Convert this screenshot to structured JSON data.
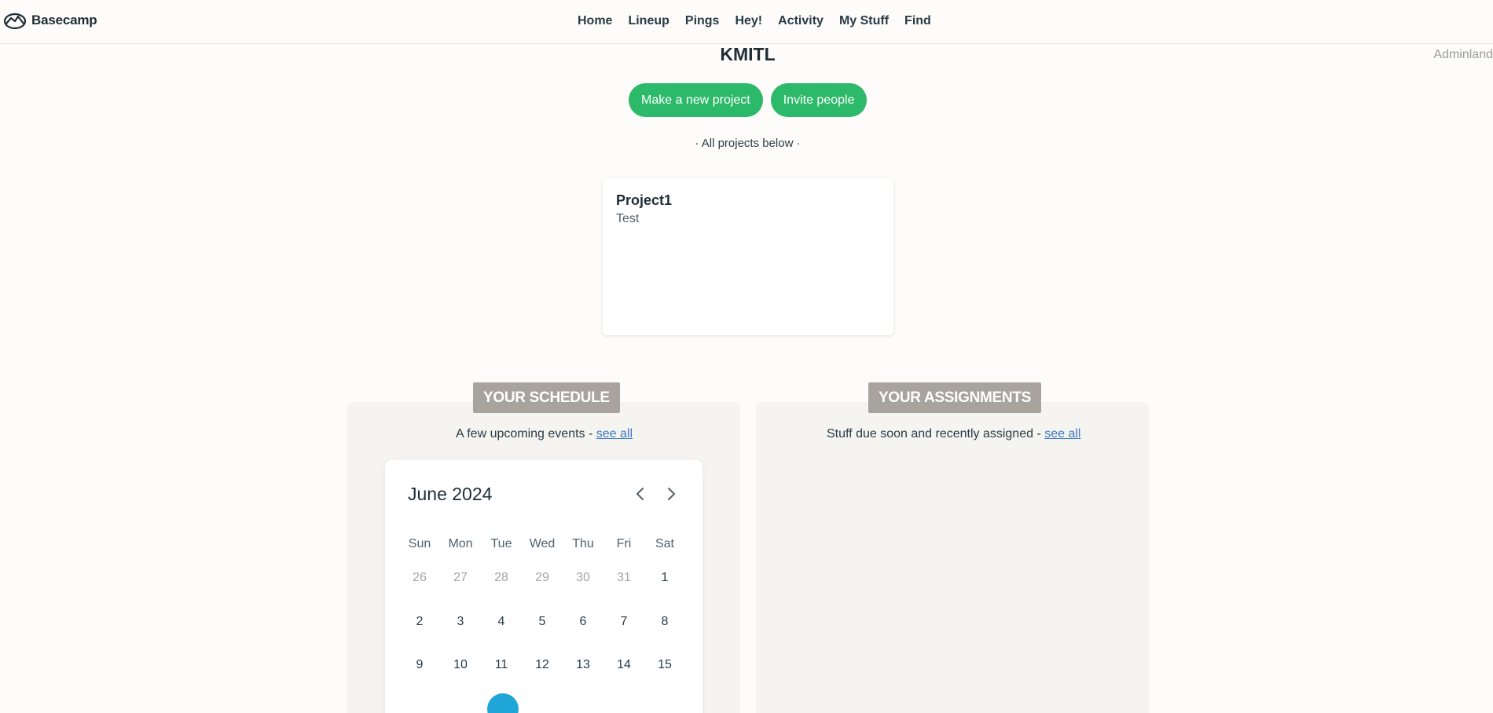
{
  "brand": {
    "name": "Basecamp"
  },
  "nav": {
    "items": [
      {
        "label": "Home"
      },
      {
        "label": "Lineup"
      },
      {
        "label": "Pings"
      },
      {
        "label": "Hey!"
      },
      {
        "label": "Activity"
      },
      {
        "label": "My Stuff"
      },
      {
        "label": "Find"
      }
    ]
  },
  "adminland": "Adminland",
  "account_name": "KMITL",
  "actions": {
    "new_project": "Make a new project",
    "invite": "Invite people"
  },
  "projects_note": "· All projects below ·",
  "project": {
    "name": "Project1",
    "description": "Test"
  },
  "schedule": {
    "tag": "YOUR SCHEDULE",
    "subtitle": "A few upcoming events - ",
    "see_all": "see all",
    "calendar": {
      "month_label": "June 2024",
      "weekdays": [
        "Sun",
        "Mon",
        "Tue",
        "Wed",
        "Thu",
        "Fri",
        "Sat"
      ],
      "weeks": [
        [
          {
            "d": "26",
            "muted": true
          },
          {
            "d": "27",
            "muted": true
          },
          {
            "d": "28",
            "muted": true
          },
          {
            "d": "29",
            "muted": true
          },
          {
            "d": "30",
            "muted": true
          },
          {
            "d": "31",
            "muted": true
          },
          {
            "d": "1"
          }
        ],
        [
          {
            "d": "2"
          },
          {
            "d": "3"
          },
          {
            "d": "4"
          },
          {
            "d": "5"
          },
          {
            "d": "6"
          },
          {
            "d": "7"
          },
          {
            "d": "8"
          }
        ],
        [
          {
            "d": "9"
          },
          {
            "d": "10"
          },
          {
            "d": "11"
          },
          {
            "d": "12"
          },
          {
            "d": "13"
          },
          {
            "d": "14"
          },
          {
            "d": "15"
          }
        ],
        [
          {
            "d": ""
          },
          {
            "d": ""
          },
          {
            "d": "",
            "today": true
          },
          {
            "d": ""
          },
          {
            "d": ""
          },
          {
            "d": ""
          },
          {
            "d": ""
          }
        ]
      ]
    }
  },
  "assignments": {
    "tag": "YOUR ASSIGNMENTS",
    "subtitle": "Stuff due soon and recently assigned - ",
    "see_all": "see all"
  },
  "colors": {
    "primary_button": "#2cb96a",
    "today_dot": "#20a5d8",
    "tag_bg": "#a8a49d"
  }
}
